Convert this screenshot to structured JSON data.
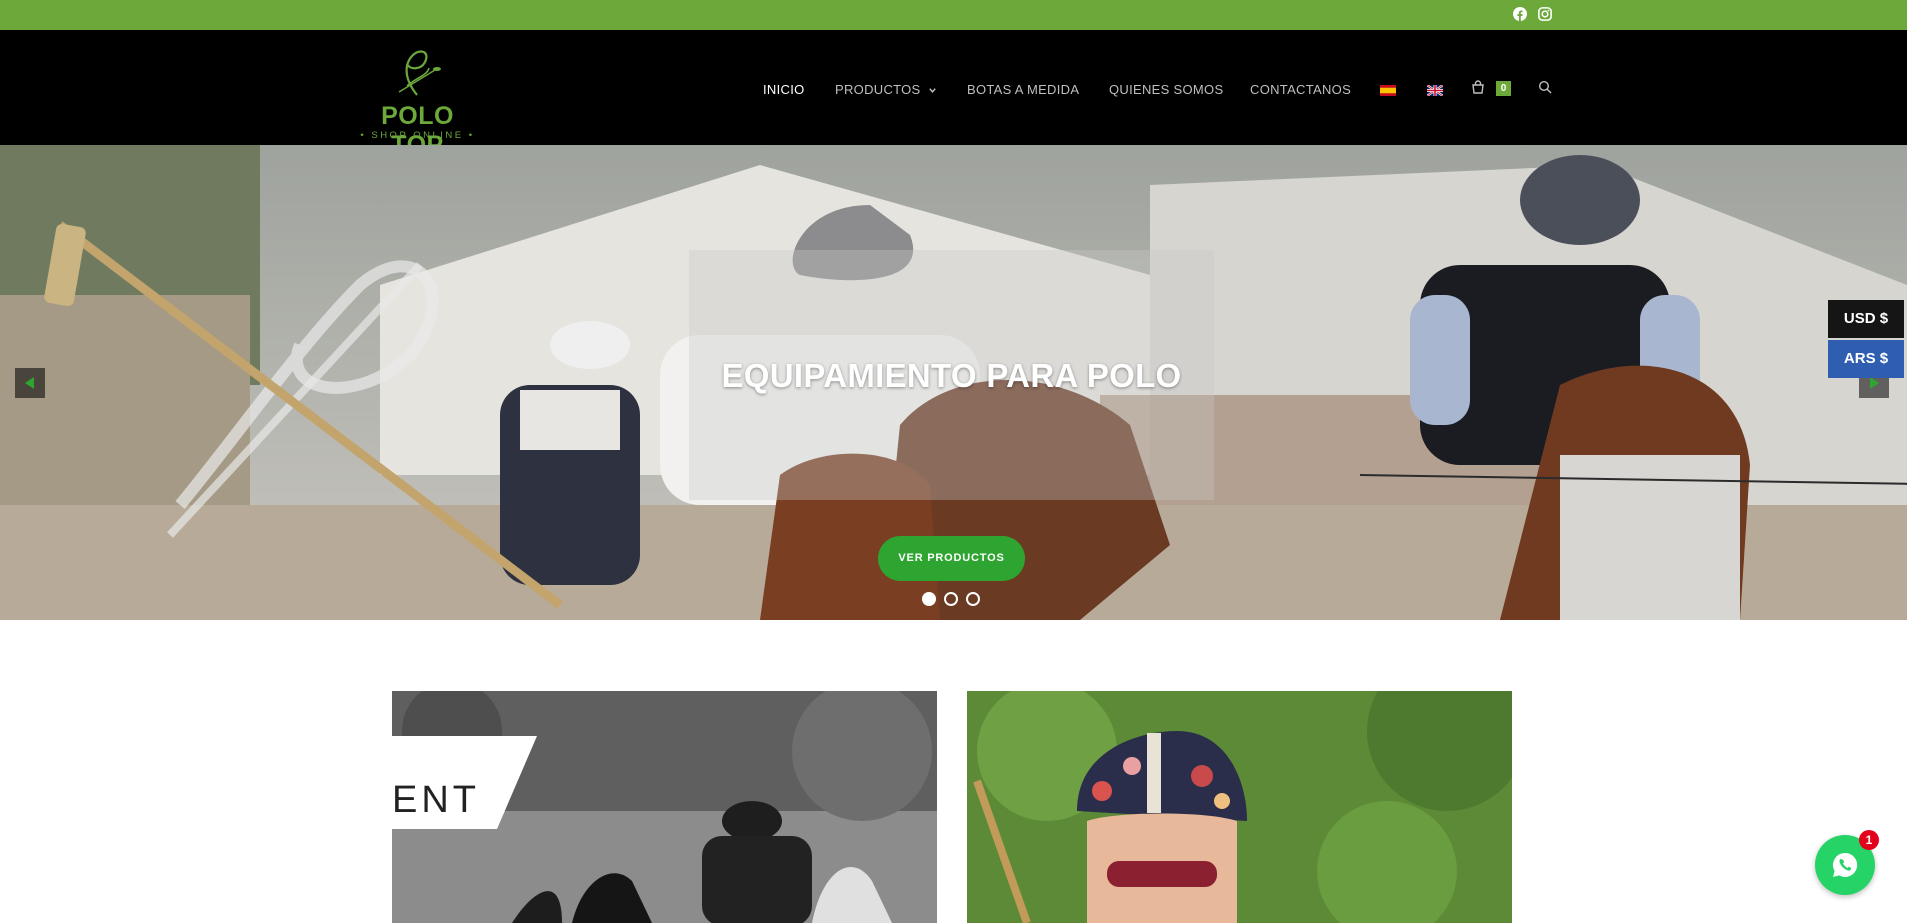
{
  "topbar": {
    "social": [
      {
        "icon": "facebook-icon"
      },
      {
        "icon": "instagram-icon"
      }
    ]
  },
  "logo": {
    "title": "POLO TOP",
    "subtitle": "• SHOP ONLINE •"
  },
  "nav": {
    "items": [
      {
        "label": "INICIO",
        "active": true
      },
      {
        "label": "PRODUCTOS",
        "has_dropdown": true
      },
      {
        "label": "BOTAS A MEDIDA"
      },
      {
        "label": "QUIENES SOMOS"
      },
      {
        "label": "CONTACTANOS"
      }
    ],
    "languages": [
      "es-flag-icon",
      "uk-flag-icon"
    ],
    "cart_count": "0"
  },
  "hero": {
    "title": "EQUIPAMIENTO PARA POLO",
    "cta": "VER PRODUCTOS",
    "slides": 3,
    "active_slide": 1
  },
  "currency": {
    "options": [
      "USD $",
      "ARS $"
    ]
  },
  "cards": {
    "left_banner_line1": ")",
    "left_banner_line2": "ENT"
  },
  "whatsapp": {
    "badge": "1"
  },
  "colors": {
    "brand_green": "#6ca83a",
    "cta_green": "#2fa531",
    "header_bg": "#000000",
    "usd_bg": "#151515",
    "ars_bg": "#2f5eb0",
    "whatsapp": "#25d366"
  }
}
